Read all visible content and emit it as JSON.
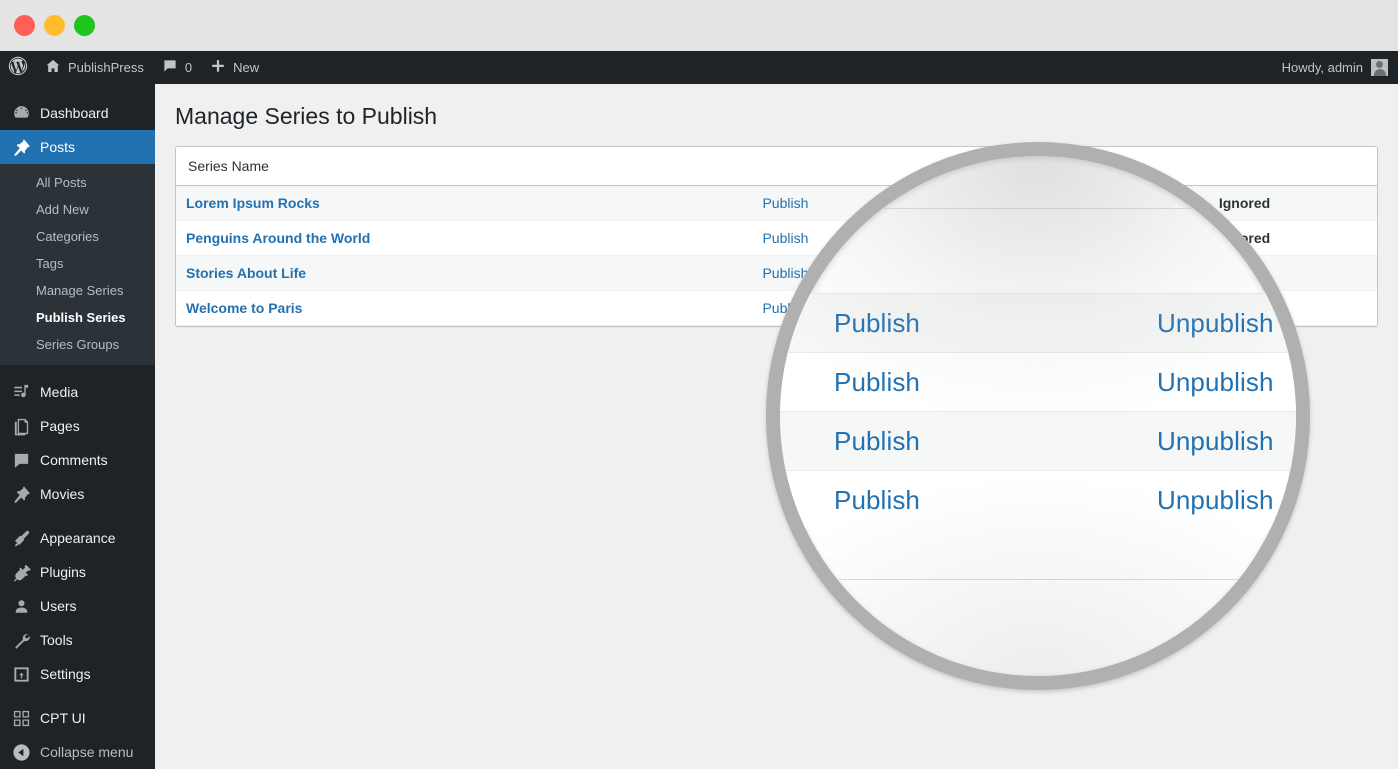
{
  "window": {
    "traffic_lights": [
      {
        "name": "close",
        "color": "#ff5f57"
      },
      {
        "name": "minimize",
        "color": "#ffbd2e"
      },
      {
        "name": "zoom",
        "color": "#1ec51e"
      }
    ]
  },
  "adminbar": {
    "logo_icon": "wordpress-icon",
    "site_name": "PublishPress",
    "site_icon": "home-icon",
    "comments_icon": "comment-bubble-icon",
    "comments_count": "0",
    "new_icon": "plus-icon",
    "new_label": "New",
    "greeting": "Howdy, admin",
    "avatar_icon": "avatar-icon"
  },
  "sidebar": {
    "items": [
      {
        "label": "Dashboard",
        "icon": "dashboard-icon",
        "current": false
      },
      {
        "label": "Posts",
        "icon": "pin-icon",
        "current": true
      },
      {
        "label": "Media",
        "icon": "media-icon",
        "current": false
      },
      {
        "label": "Pages",
        "icon": "pages-icon",
        "current": false
      },
      {
        "label": "Comments",
        "icon": "comment-bubble-icon",
        "current": false
      },
      {
        "label": "Movies",
        "icon": "pin-icon",
        "current": false
      },
      {
        "label": "Appearance",
        "icon": "paintbrush-icon",
        "current": false
      },
      {
        "label": "Plugins",
        "icon": "plug-icon",
        "current": false
      },
      {
        "label": "Users",
        "icon": "user-icon",
        "current": false
      },
      {
        "label": "Tools",
        "icon": "wrench-icon",
        "current": false
      },
      {
        "label": "Settings",
        "icon": "settings-icon",
        "current": false
      },
      {
        "label": "CPT UI",
        "icon": "cpt-ui-icon",
        "current": false
      }
    ],
    "submenu": [
      {
        "label": "All Posts",
        "current": false
      },
      {
        "label": "Add New",
        "current": false
      },
      {
        "label": "Categories",
        "current": false
      },
      {
        "label": "Tags",
        "current": false
      },
      {
        "label": "Manage Series",
        "current": false
      },
      {
        "label": "Publish Series",
        "current": true
      },
      {
        "label": "Series Groups",
        "current": false
      }
    ],
    "collapse": {
      "label": "Collapse menu",
      "icon": "collapse-arrow-icon"
    }
  },
  "main": {
    "page_title": "Manage Series to Publish",
    "table": {
      "columns": [
        "Series Name",
        "",
        "",
        ""
      ],
      "rows": [
        {
          "name": "Lorem Ipsum Rocks",
          "publish": "Publish",
          "unpublish": "Unpublish",
          "status": "Ignored"
        },
        {
          "name": "Penguins Around the World",
          "publish": "Publish",
          "unpublish": "Unpublish",
          "status": "Ignored"
        },
        {
          "name": "Stories About Life",
          "publish": "Publish",
          "unpublish": "Unpublish",
          "status": ""
        },
        {
          "name": "Welcome to Paris",
          "publish": "Publish",
          "unpublish": "Unpublish",
          "status": ""
        }
      ]
    }
  },
  "magnifier": {
    "name": "magnifier-overlay",
    "rows": [
      {
        "publish": "Publish",
        "unpublish": "Unpublish"
      },
      {
        "publish": "Publish",
        "unpublish": "Unpublish"
      },
      {
        "publish": "Publish",
        "unpublish": "Unpublish"
      },
      {
        "publish": "Publish",
        "unpublish": "Unpublish"
      }
    ]
  },
  "colors": {
    "wp_blue_link": "#2271b1",
    "admin_dark": "#1d2327",
    "submenu_dark": "#2c3338",
    "content_bg": "#f0f0f1",
    "row_stripe": "#f6f7f7",
    "magnifier_ring": "#b0b0b0"
  }
}
